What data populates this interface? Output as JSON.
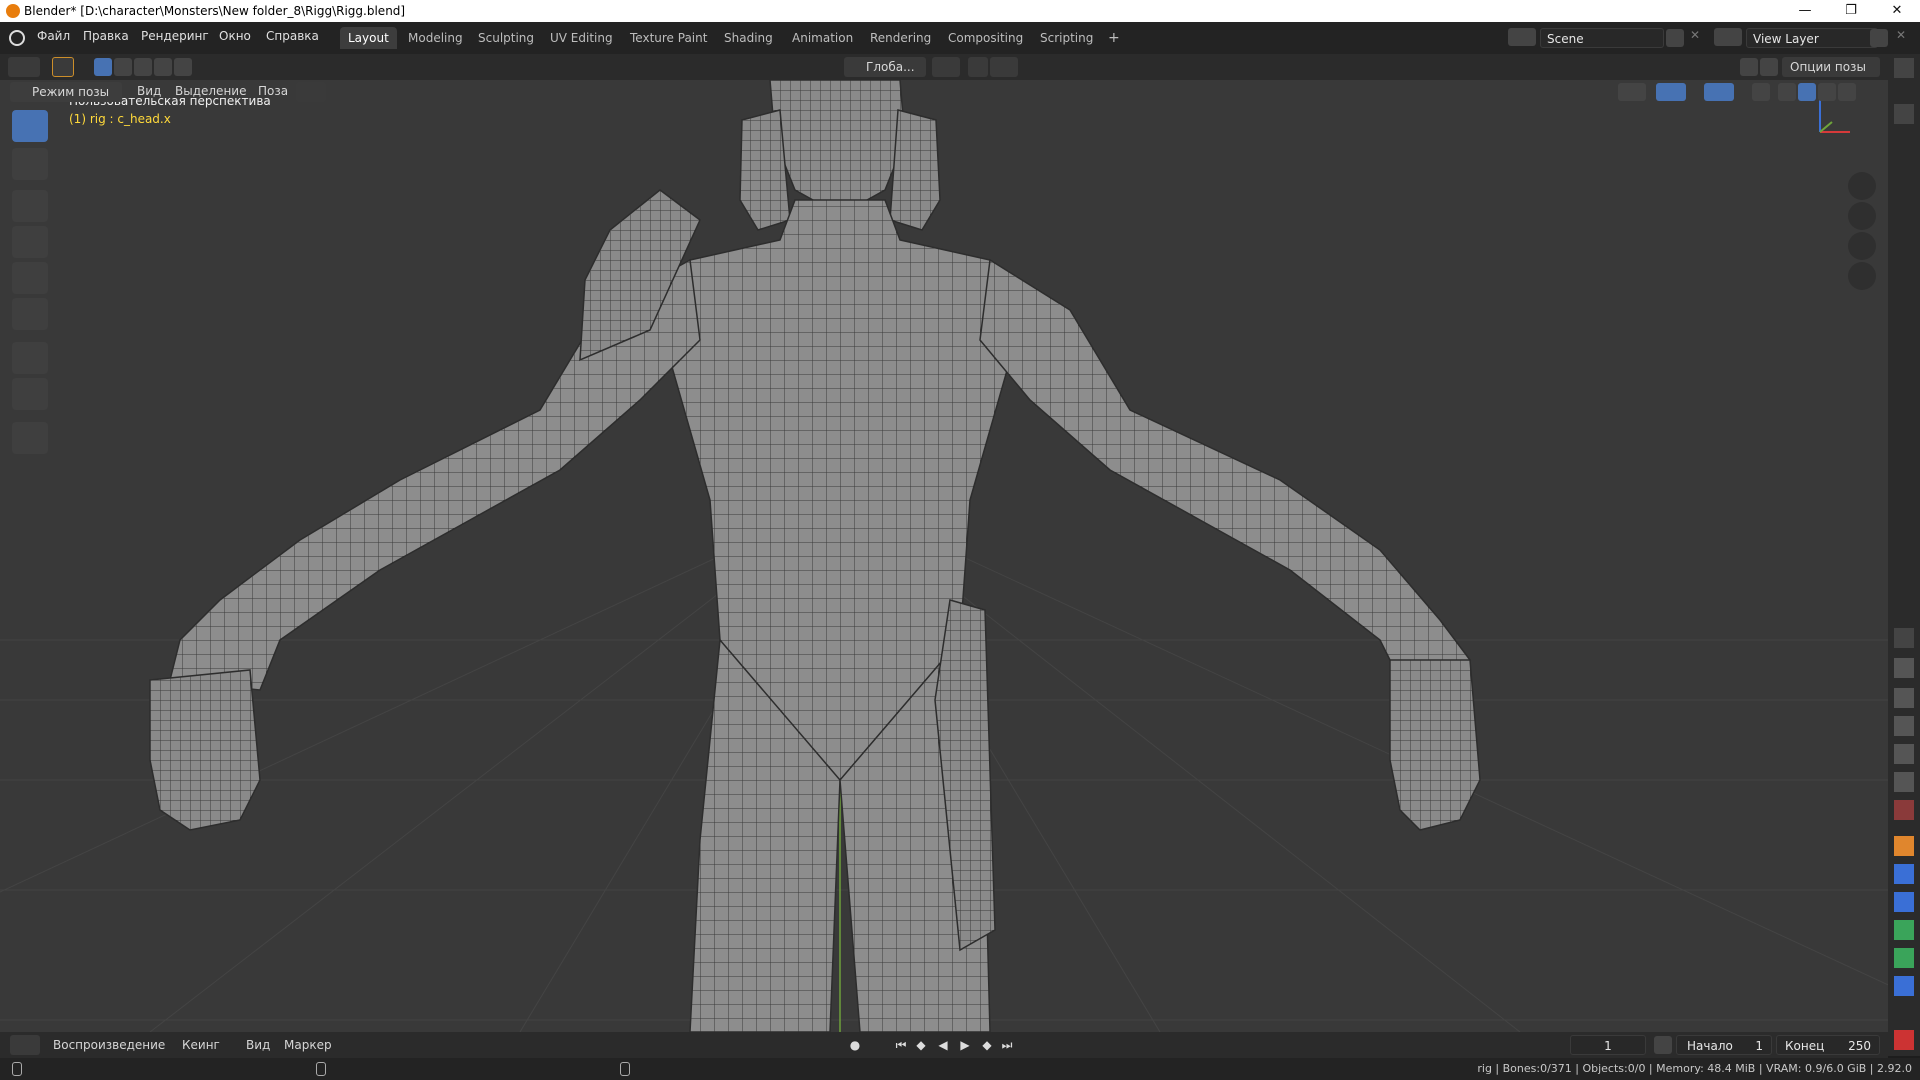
{
  "window": {
    "title": "Blender* [D:\\character\\Monsters\\New folder_8\\Rigg\\Rigg.blend]",
    "minimize": "—",
    "maximize": "❐",
    "close": "✕"
  },
  "menu": [
    "Файл",
    "Правка",
    "Рендеринг",
    "Окно",
    "Справка"
  ],
  "workspaces": {
    "active": "Layout",
    "tabs": [
      "Layout",
      "Modeling",
      "Sculpting",
      "UV Editing",
      "Texture Paint",
      "Shading",
      "Animation",
      "Rendering",
      "Compositing",
      "Scripting"
    ],
    "add": "+"
  },
  "scene": {
    "name": "Scene",
    "view_layer": "View Layer"
  },
  "tool_header": {
    "transform_orientation": "Глоба...",
    "pose_options": "Опции позы"
  },
  "viewport_header": {
    "mode": "Режим позы",
    "menus": [
      "Вид",
      "Выделение",
      "Поза"
    ]
  },
  "viewport": {
    "perspective": "Пользовательская перспектива",
    "active_object": "(1) rig : c_head.x"
  },
  "toolbar_tools": [
    "select-box",
    "cursor",
    "move",
    "rotate",
    "scale",
    "transform",
    "annotate",
    "measure",
    "relax"
  ],
  "timeline": {
    "playback": "Воспроизведение",
    "keying": "Кеинг",
    "view": "Вид",
    "marker": "Маркер",
    "current_frame": "1",
    "start_label": "Начало",
    "start": "1",
    "end_label": "Конец",
    "end": "250"
  },
  "status": {
    "text": "rig | Bones:0/371 | Objects:0/0 | Memory: 48.4 MiB | VRAM: 0.9/6.0 GiB | 2.92.0"
  },
  "colors": {
    "accent": "#4772b3",
    "active_object_text": "#ffd93b",
    "axis_x": "#d63a3a",
    "axis_y": "#6fa43a",
    "axis_z": "#3a6fd6",
    "viewport_bg": "#393939"
  }
}
